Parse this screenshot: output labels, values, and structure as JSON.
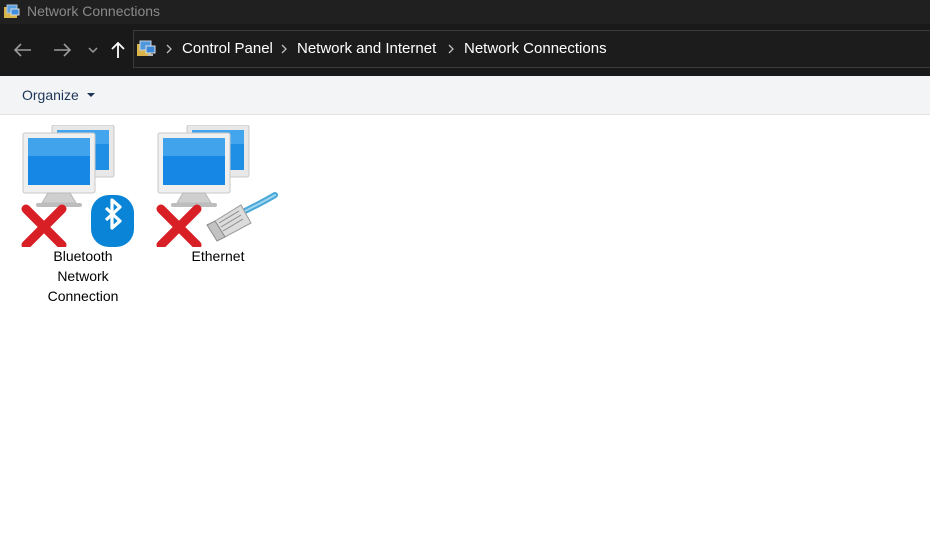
{
  "window": {
    "title": "Network Connections"
  },
  "nav": {
    "back_icon": "back-arrow-icon",
    "forward_icon": "forward-arrow-icon",
    "recent_icon": "chevron-down-icon",
    "up_icon": "up-arrow-icon"
  },
  "address": {
    "icon": "network-folder-icon",
    "crumbs": [
      "Control Panel",
      "Network and Internet",
      "Network Connections"
    ]
  },
  "toolbar": {
    "organize_label": "Organize"
  },
  "items": [
    {
      "label_lines": [
        "Bluetooth",
        "Network",
        "Connection"
      ],
      "icon": "bluetooth-network-connection-icon",
      "status": "disconnected"
    },
    {
      "label_lines": [
        "Ethernet"
      ],
      "icon": "ethernet-connection-icon",
      "status": "disconnected"
    }
  ],
  "colors": {
    "titlebar_bg": "#202020",
    "navbar_bg": "#191919",
    "commandbar_bg": "#f3f4f6",
    "accent_blue": "#0a84d6",
    "error_red": "#d81f26"
  }
}
